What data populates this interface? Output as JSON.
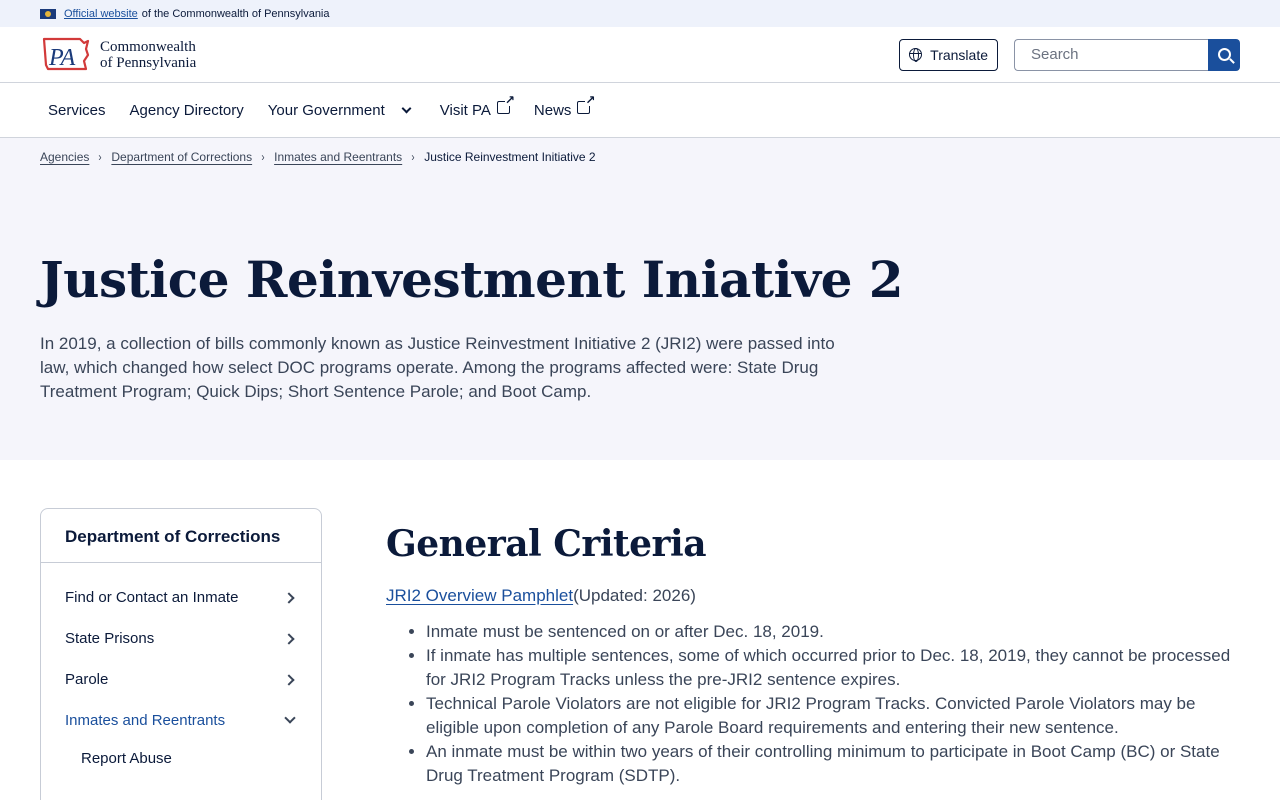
{
  "official_bar": {
    "link_text": "Official website",
    "suffix_text": "of the Commonwealth of Pennsylvania"
  },
  "header": {
    "logo_mark": "PA",
    "logo_line1": "Commonwealth",
    "logo_line2": "of Pennsylvania",
    "translate_label": "Translate",
    "search_placeholder": "Search"
  },
  "nav": {
    "items": [
      {
        "label": "Services"
      },
      {
        "label": "Agency Directory"
      },
      {
        "label": "Your Government"
      },
      {
        "label": "Visit PA"
      },
      {
        "label": "News"
      }
    ]
  },
  "breadcrumb": {
    "items": [
      {
        "label": "Agencies"
      },
      {
        "label": "Department of Corrections"
      },
      {
        "label": "Inmates and Reentrants"
      }
    ],
    "current": "Justice Reinvestment Initiative 2"
  },
  "hero": {
    "title": "Justice Reinvestment Iniative 2",
    "intro": "In 2019, a collection of bills commonly known as Justice Reinvestment Initiative 2 (JRI2) were passed into law, which changed how select DOC programs operate. Among the programs affected were: State Drug Treatment Program; Quick Dips; Short Sentence Parole; and Boot Camp."
  },
  "sidebar": {
    "title": "Department of Corrections",
    "items": [
      {
        "label": "Find or Contact an Inmate"
      },
      {
        "label": "State Prisons"
      },
      {
        "label": "Parole"
      },
      {
        "label": "Inmates and Reentrants"
      }
    ],
    "sub_items": [
      {
        "label": "Report Abuse"
      }
    ]
  },
  "content": {
    "section_title": "General Criteria",
    "pamphlet_link": "JRI2 Overview Pamphlet",
    "pamphlet_suffix": "(Updated: 2026)",
    "criteria": [
      "Inmate must be sentenced on or after Dec. 18, 2019.",
      "If inmate has multiple sentences, some of which occurred prior to Dec. 18, 2019, they cannot be processed for JRI2 Program Tracks unless the pre-JRI2 sentence expires.",
      "Technical Parole Violators are not eligible for JRI2 Program Tracks. Convicted Parole Violators may be eligible upon completion of any Parole Board requirements and entering their new sentence.",
      "An inmate must be within two years of their controlling minimum to participate in Boot Camp (BC) or State Drug Treatment Program (SDTP)."
    ]
  },
  "colors": {
    "navy": "#0b1a3a",
    "link_blue": "#1a4f9c",
    "hero_bg": "#f5f5fb",
    "banner_bg": "#eef2fb",
    "logo_red": "#d23a3a"
  },
  "icons": {
    "flag": "pa-flag-icon",
    "globe": "globe-icon",
    "search": "search-icon",
    "chevron_down": "chevron-down-icon",
    "external": "external-link-icon",
    "chevron_right": "chevron-right-icon"
  }
}
